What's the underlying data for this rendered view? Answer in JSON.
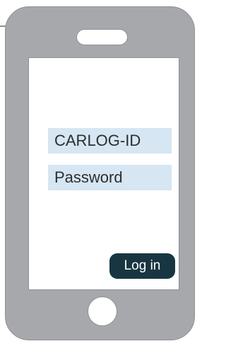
{
  "login": {
    "id_field": "CARLOG-ID",
    "password_field": "Password",
    "button_label": "Log in"
  },
  "colors": {
    "phone_body": "#a6a8ab",
    "field_background": "#d6e6f2",
    "button_background": "#173641"
  }
}
